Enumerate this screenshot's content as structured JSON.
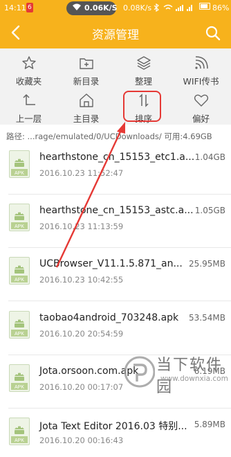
{
  "status_bar": {
    "time": "14:11",
    "badge": "6",
    "speed": "0.06K/S",
    "right_speed": "0.08K/s",
    "battery": "86%"
  },
  "header": {
    "title": "资源管理"
  },
  "toolbar": {
    "items": [
      {
        "label": "收藏夹",
        "icon": "star-icon"
      },
      {
        "label": "新目录",
        "icon": "new-folder-icon"
      },
      {
        "label": "整理",
        "icon": "layers-icon"
      },
      {
        "label": "WIFI传书",
        "icon": "wifi-icon"
      },
      {
        "label": "上一层",
        "icon": "up-level-icon"
      },
      {
        "label": "主目录",
        "icon": "home-icon"
      },
      {
        "label": "排序",
        "icon": "sort-icon"
      },
      {
        "label": "偏好",
        "icon": "heart-icon"
      }
    ]
  },
  "path": {
    "text": "路径: ...rage/emulated/0/UCDownloads/  可用:4.69GB"
  },
  "files": [
    {
      "name": "hearthstone_cn_15153_etc1.a...",
      "date": "2016.10.23 11:52:47",
      "size": "1.04GB",
      "icon_label": "APK"
    },
    {
      "name": "hearthstone_cn_15153_astc.a...",
      "date": "2016.10.23 11:13:59",
      "size": "1.05GB",
      "icon_label": "APK"
    },
    {
      "name": "UCBrowser_V11.1.5.871_an...",
      "date": "2016.10.23 10:42:55",
      "size": "25.95MB",
      "icon_label": "APK"
    },
    {
      "name": "taobao4android_703248.apk",
      "date": "2016.10.20 20:54:59",
      "size": "53.54MB",
      "icon_label": "APK"
    },
    {
      "name": "Jota.orsoon.com.apk",
      "date": "2016.10.20 00:17:07",
      "size": "6.19MB",
      "icon_label": "APK"
    },
    {
      "name": "Jota  Text Editor 2016.03 特别...",
      "date": "2016.10.20 00:16:43",
      "size": "5.89MB",
      "icon_label": "APK"
    }
  ],
  "watermark": {
    "title": "当下软件园",
    "url": "www.downxia.com"
  },
  "colors": {
    "accent": "#f7b21c",
    "highlight": "#e53935"
  }
}
